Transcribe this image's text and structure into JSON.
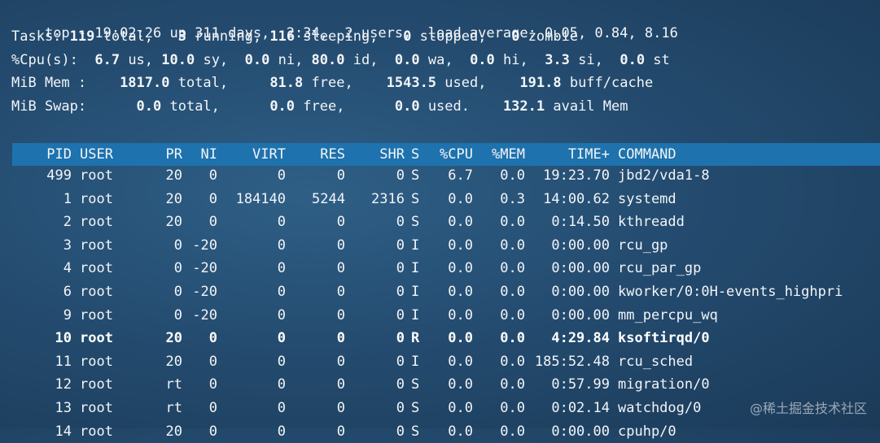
{
  "summary": {
    "line1": {
      "prefix": "top - 19:02:26 up 311 days,  2:34,  2 users,  load average: 0.05, 0.84, 8.16"
    },
    "line2": {
      "label": "Tasks: ",
      "total": "119",
      "total_label": " total,   ",
      "running": "3",
      "running_label": " running, ",
      "sleeping": "116",
      "sleeping_label": " sleeping,   ",
      "stopped": "0",
      "stopped_label": " stopped,   ",
      "zombie": "0",
      "zombie_label": " zombie"
    },
    "line3": {
      "label": "%Cpu(s):  ",
      "us": "6.7",
      "us_label": " us, ",
      "sy": "10.0",
      "sy_label": " sy,  ",
      "ni": "0.0",
      "ni_label": " ni, ",
      "id": "80.0",
      "id_label": " id,  ",
      "wa": "0.0",
      "wa_label": " wa,  ",
      "hi": "0.0",
      "hi_label": " hi,  ",
      "si": "3.3",
      "si_label": " si,  ",
      "st": "0.0",
      "st_label": " st"
    },
    "line4": {
      "label": "MiB Mem :    ",
      "total": "1817.0",
      "total_label": " total,     ",
      "free": "81.8",
      "free_label": " free,    ",
      "used": "1543.5",
      "used_label": " used,    ",
      "cache": "191.8",
      "cache_label": " buff/cache"
    },
    "line5": {
      "label": "MiB Swap:      ",
      "total": "0.0",
      "total_label": " total,      ",
      "free": "0.0",
      "free_label": " free,      ",
      "used": "0.0",
      "used_label": " used.    ",
      "avail": "132.1",
      "avail_label": " avail Mem"
    }
  },
  "columns": [
    "PID",
    "USER",
    "PR",
    "NI",
    "VIRT",
    "RES",
    "SHR",
    "S",
    "%CPU",
    "%MEM",
    "TIME+",
    "COMMAND"
  ],
  "processes": [
    {
      "pid": "499",
      "user": "root",
      "pr": "20",
      "ni": "0",
      "virt": "0",
      "res": "0",
      "shr": "0",
      "s": "S",
      "cpu": "6.7",
      "mem": "0.0",
      "time": "19:23.70",
      "command": "jbd2/vda1-8",
      "bold": false
    },
    {
      "pid": "1",
      "user": "root",
      "pr": "20",
      "ni": "0",
      "virt": "184140",
      "res": "5244",
      "shr": "2316",
      "s": "S",
      "cpu": "0.0",
      "mem": "0.3",
      "time": "14:00.62",
      "command": "systemd",
      "bold": false
    },
    {
      "pid": "2",
      "user": "root",
      "pr": "20",
      "ni": "0",
      "virt": "0",
      "res": "0",
      "shr": "0",
      "s": "S",
      "cpu": "0.0",
      "mem": "0.0",
      "time": "0:14.50",
      "command": "kthreadd",
      "bold": false
    },
    {
      "pid": "3",
      "user": "root",
      "pr": "0",
      "ni": "-20",
      "virt": "0",
      "res": "0",
      "shr": "0",
      "s": "I",
      "cpu": "0.0",
      "mem": "0.0",
      "time": "0:00.00",
      "command": "rcu_gp",
      "bold": false
    },
    {
      "pid": "4",
      "user": "root",
      "pr": "0",
      "ni": "-20",
      "virt": "0",
      "res": "0",
      "shr": "0",
      "s": "I",
      "cpu": "0.0",
      "mem": "0.0",
      "time": "0:00.00",
      "command": "rcu_par_gp",
      "bold": false
    },
    {
      "pid": "6",
      "user": "root",
      "pr": "0",
      "ni": "-20",
      "virt": "0",
      "res": "0",
      "shr": "0",
      "s": "I",
      "cpu": "0.0",
      "mem": "0.0",
      "time": "0:00.00",
      "command": "kworker/0:0H-events_highpri",
      "bold": false
    },
    {
      "pid": "9",
      "user": "root",
      "pr": "0",
      "ni": "-20",
      "virt": "0",
      "res": "0",
      "shr": "0",
      "s": "I",
      "cpu": "0.0",
      "mem": "0.0",
      "time": "0:00.00",
      "command": "mm_percpu_wq",
      "bold": false
    },
    {
      "pid": "10",
      "user": "root",
      "pr": "20",
      "ni": "0",
      "virt": "0",
      "res": "0",
      "shr": "0",
      "s": "R",
      "cpu": "0.0",
      "mem": "0.0",
      "time": "4:29.84",
      "command": "ksoftirqd/0",
      "bold": true
    },
    {
      "pid": "11",
      "user": "root",
      "pr": "20",
      "ni": "0",
      "virt": "0",
      "res": "0",
      "shr": "0",
      "s": "I",
      "cpu": "0.0",
      "mem": "0.0",
      "time": "185:52.48",
      "command": "rcu_sched",
      "bold": false
    },
    {
      "pid": "12",
      "user": "root",
      "pr": "rt",
      "ni": "0",
      "virt": "0",
      "res": "0",
      "shr": "0",
      "s": "S",
      "cpu": "0.0",
      "mem": "0.0",
      "time": "0:57.99",
      "command": "migration/0",
      "bold": false
    },
    {
      "pid": "13",
      "user": "root",
      "pr": "rt",
      "ni": "0",
      "virt": "0",
      "res": "0",
      "shr": "0",
      "s": "S",
      "cpu": "0.0",
      "mem": "0.0",
      "time": "0:02.14",
      "command": "watchdog/0",
      "bold": false
    },
    {
      "pid": "14",
      "user": "root",
      "pr": "20",
      "ni": "0",
      "virt": "0",
      "res": "0",
      "shr": "0",
      "s": "S",
      "cpu": "0.0",
      "mem": "0.0",
      "time": "0:00.00",
      "command": "cpuhp/0",
      "bold": false
    }
  ],
  "watermark": "@稀土掘金技术社区",
  "colors": {
    "header_bar": "#1e72ad",
    "background": "#244c70",
    "text": "#f2f5f8"
  }
}
